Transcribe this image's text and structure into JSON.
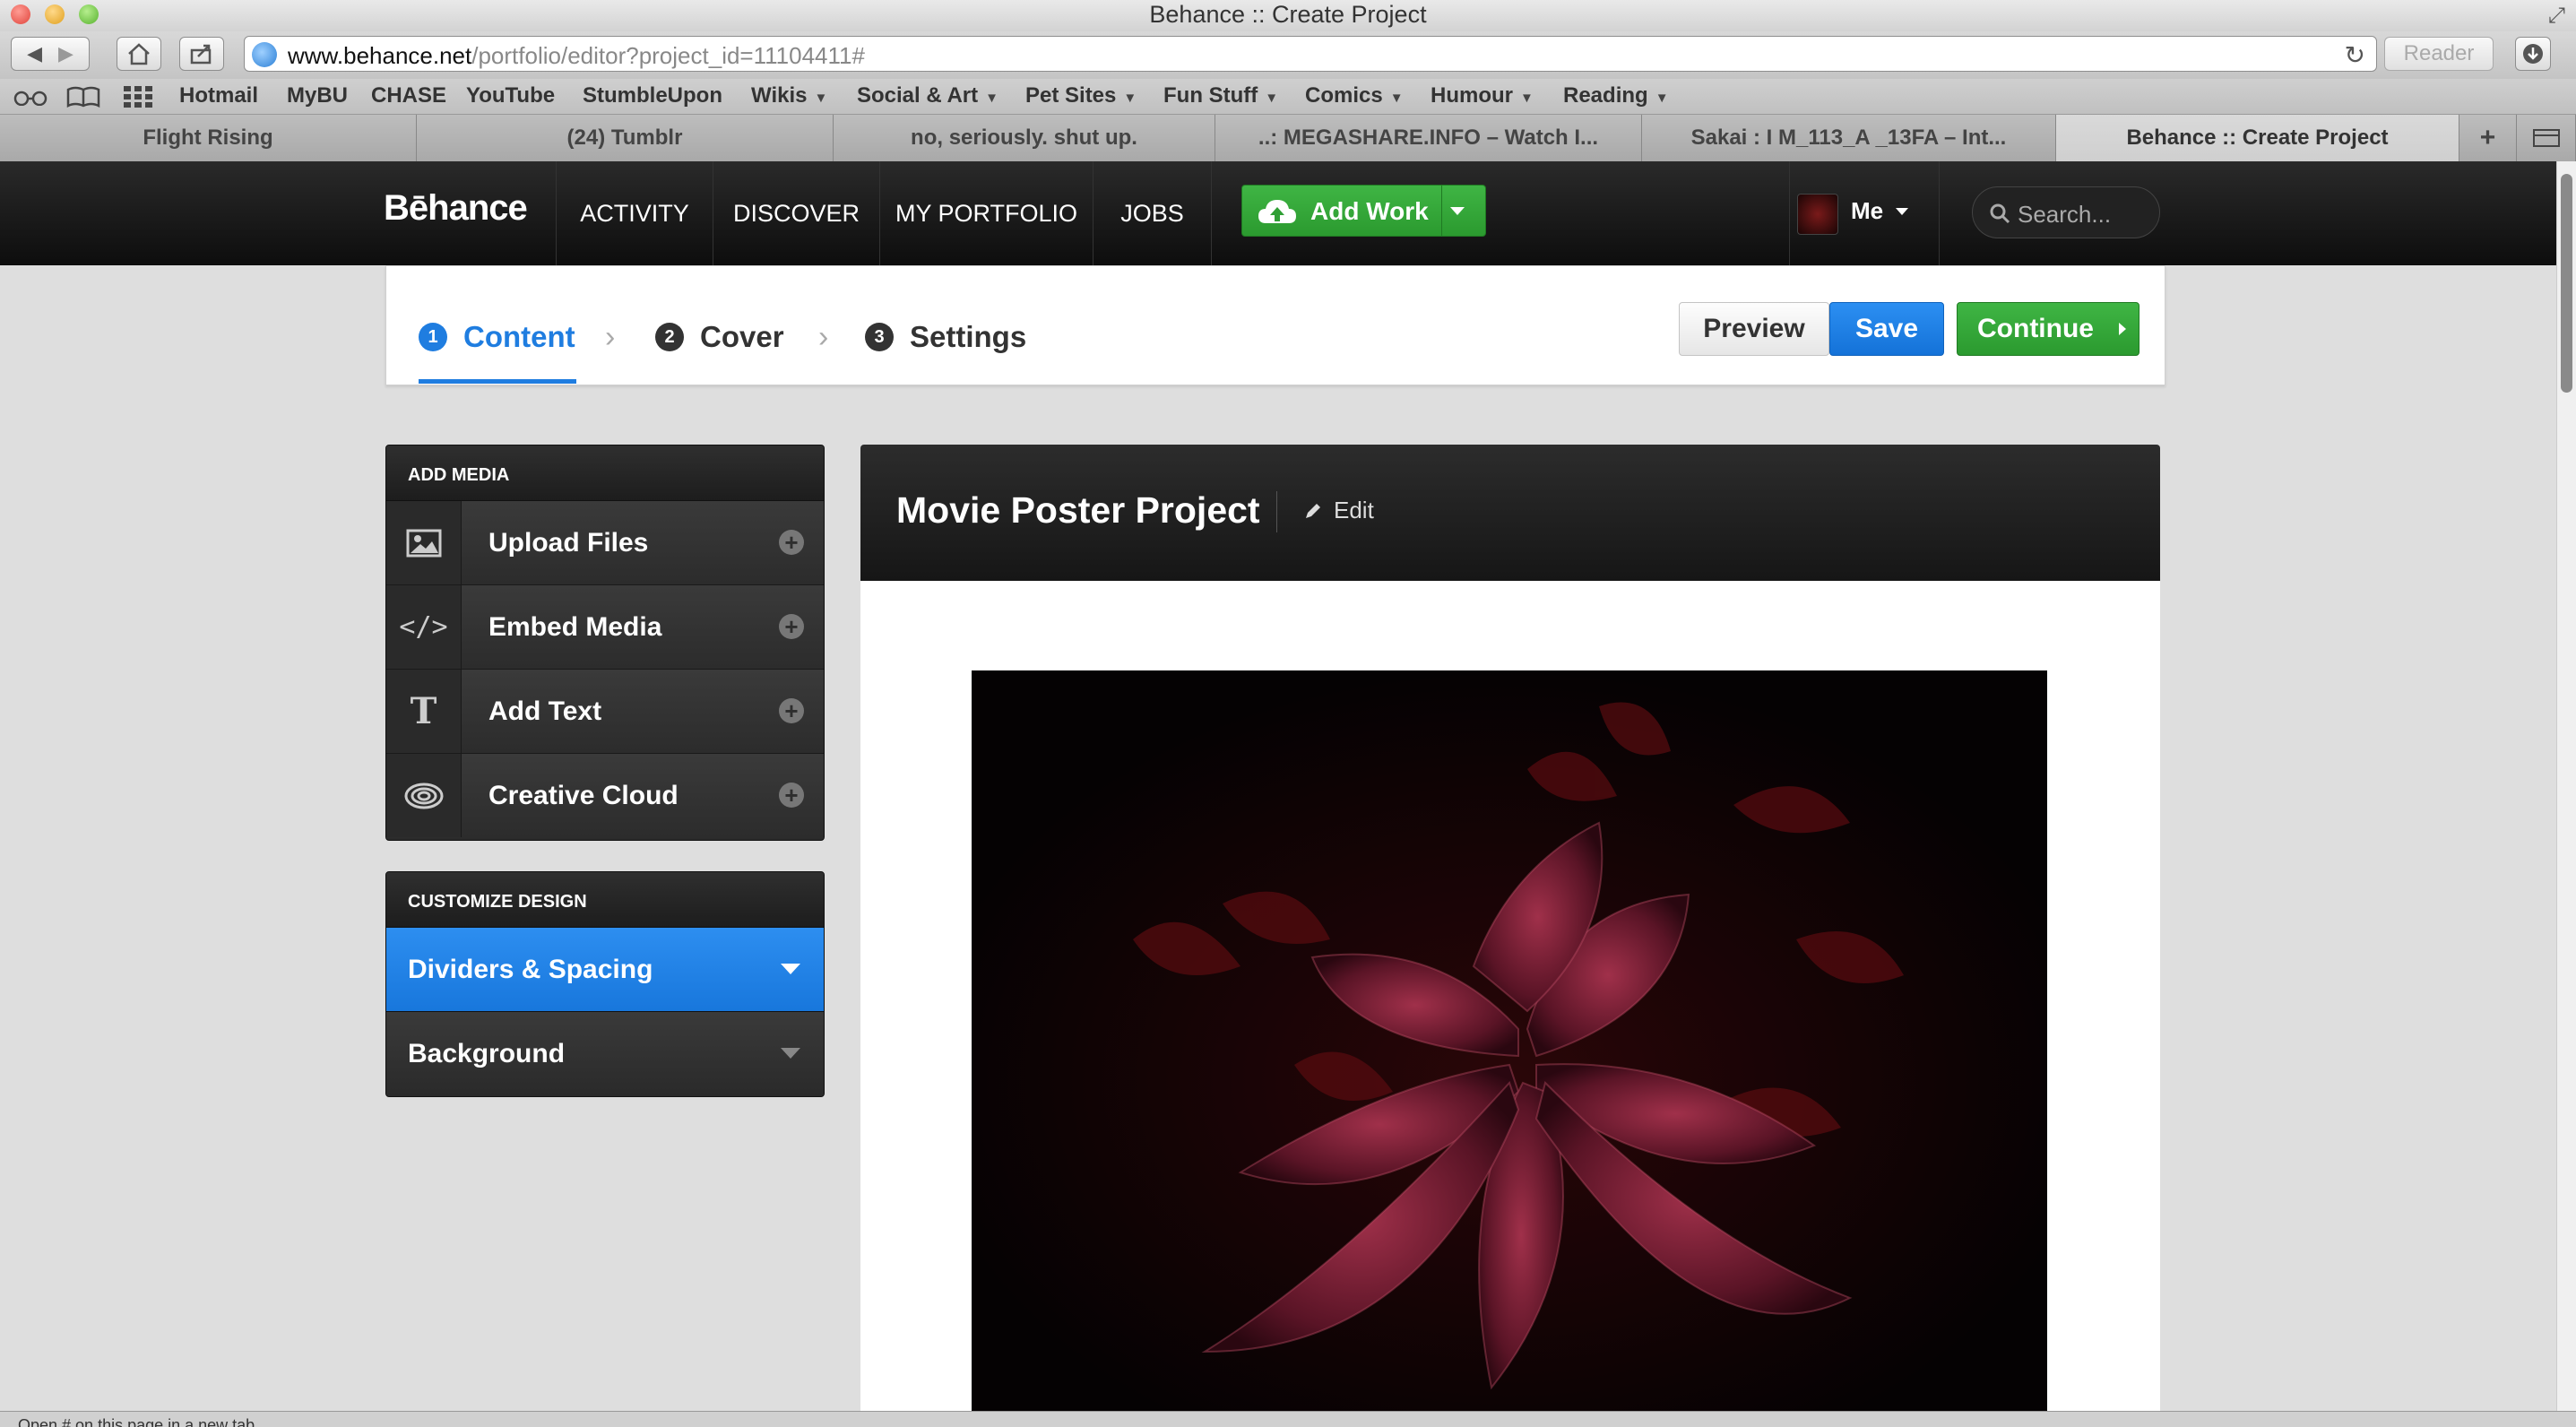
{
  "window": {
    "title": "Behance :: Create Project"
  },
  "browser": {
    "url_host": "www.behance.net",
    "url_path": "/portfolio/editor?project_id=11104411#",
    "reader_label": "Reader"
  },
  "bookmarks": [
    {
      "label": "Hotmail"
    },
    {
      "label": "MyBU"
    },
    {
      "label": "CHASE"
    },
    {
      "label": "YouTube"
    },
    {
      "label": "StumbleUpon"
    },
    {
      "label": "Wikis",
      "menu": true
    },
    {
      "label": "Social & Art",
      "menu": true
    },
    {
      "label": "Pet Sites",
      "menu": true
    },
    {
      "label": "Fun Stuff",
      "menu": true
    },
    {
      "label": "Comics",
      "menu": true
    },
    {
      "label": "Humour",
      "menu": true
    },
    {
      "label": "Reading",
      "menu": true
    }
  ],
  "tabs": [
    {
      "label": "Flight Rising"
    },
    {
      "label": "(24) Tumblr"
    },
    {
      "label": "no, seriously. shut up."
    },
    {
      "label": "..: MEGASHARE.INFO – Watch I..."
    },
    {
      "label": "Sakai : I M_113_A _13FA – Int..."
    },
    {
      "label": "Behance :: Create Project",
      "active": true
    }
  ],
  "nav": {
    "logo": "Bēhance",
    "items": [
      "ACTIVITY",
      "DISCOVER",
      "MY PORTFOLIO",
      "JOBS"
    ],
    "add_work": "Add Work",
    "me": "Me",
    "search_placeholder": "Search..."
  },
  "steps": {
    "items": [
      {
        "num": "1",
        "label": "Content"
      },
      {
        "num": "2",
        "label": "Cover"
      },
      {
        "num": "3",
        "label": "Settings"
      }
    ],
    "preview": "Preview",
    "save": "Save",
    "continue": "Continue"
  },
  "add_media": {
    "heading": "ADD MEDIA",
    "items": [
      {
        "label": "Upload Files",
        "icon": "image-icon"
      },
      {
        "label": "Embed Media",
        "icon": "code-icon"
      },
      {
        "label": "Add Text",
        "icon": "text-icon"
      },
      {
        "label": "Creative Cloud",
        "icon": "creative-cloud-icon"
      }
    ]
  },
  "customize": {
    "heading": "CUSTOMIZE DESIGN",
    "items": [
      {
        "label": "Dividers & Spacing"
      },
      {
        "label": "Background"
      }
    ]
  },
  "project": {
    "title": "Movie Poster Project",
    "edit": "Edit"
  },
  "status_text": "Open # on this page in a new tab",
  "colors": {
    "accent_blue": "#1f7de0",
    "green": "#35a83a",
    "nav_bg": "#111111"
  }
}
